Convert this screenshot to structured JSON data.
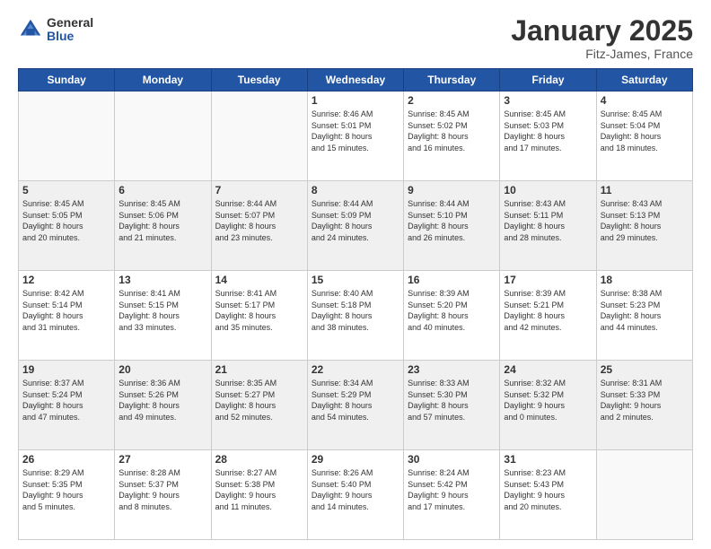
{
  "logo": {
    "general": "General",
    "blue": "Blue"
  },
  "title": "January 2025",
  "location": "Fitz-James, France",
  "days_header": [
    "Sunday",
    "Monday",
    "Tuesday",
    "Wednesday",
    "Thursday",
    "Friday",
    "Saturday"
  ],
  "weeks": [
    [
      {
        "day": "",
        "info": ""
      },
      {
        "day": "",
        "info": ""
      },
      {
        "day": "",
        "info": ""
      },
      {
        "day": "1",
        "info": "Sunrise: 8:46 AM\nSunset: 5:01 PM\nDaylight: 8 hours\nand 15 minutes."
      },
      {
        "day": "2",
        "info": "Sunrise: 8:45 AM\nSunset: 5:02 PM\nDaylight: 8 hours\nand 16 minutes."
      },
      {
        "day": "3",
        "info": "Sunrise: 8:45 AM\nSunset: 5:03 PM\nDaylight: 8 hours\nand 17 minutes."
      },
      {
        "day": "4",
        "info": "Sunrise: 8:45 AM\nSunset: 5:04 PM\nDaylight: 8 hours\nand 18 minutes."
      }
    ],
    [
      {
        "day": "5",
        "info": "Sunrise: 8:45 AM\nSunset: 5:05 PM\nDaylight: 8 hours\nand 20 minutes."
      },
      {
        "day": "6",
        "info": "Sunrise: 8:45 AM\nSunset: 5:06 PM\nDaylight: 8 hours\nand 21 minutes."
      },
      {
        "day": "7",
        "info": "Sunrise: 8:44 AM\nSunset: 5:07 PM\nDaylight: 8 hours\nand 23 minutes."
      },
      {
        "day": "8",
        "info": "Sunrise: 8:44 AM\nSunset: 5:09 PM\nDaylight: 8 hours\nand 24 minutes."
      },
      {
        "day": "9",
        "info": "Sunrise: 8:44 AM\nSunset: 5:10 PM\nDaylight: 8 hours\nand 26 minutes."
      },
      {
        "day": "10",
        "info": "Sunrise: 8:43 AM\nSunset: 5:11 PM\nDaylight: 8 hours\nand 28 minutes."
      },
      {
        "day": "11",
        "info": "Sunrise: 8:43 AM\nSunset: 5:13 PM\nDaylight: 8 hours\nand 29 minutes."
      }
    ],
    [
      {
        "day": "12",
        "info": "Sunrise: 8:42 AM\nSunset: 5:14 PM\nDaylight: 8 hours\nand 31 minutes."
      },
      {
        "day": "13",
        "info": "Sunrise: 8:41 AM\nSunset: 5:15 PM\nDaylight: 8 hours\nand 33 minutes."
      },
      {
        "day": "14",
        "info": "Sunrise: 8:41 AM\nSunset: 5:17 PM\nDaylight: 8 hours\nand 35 minutes."
      },
      {
        "day": "15",
        "info": "Sunrise: 8:40 AM\nSunset: 5:18 PM\nDaylight: 8 hours\nand 38 minutes."
      },
      {
        "day": "16",
        "info": "Sunrise: 8:39 AM\nSunset: 5:20 PM\nDaylight: 8 hours\nand 40 minutes."
      },
      {
        "day": "17",
        "info": "Sunrise: 8:39 AM\nSunset: 5:21 PM\nDaylight: 8 hours\nand 42 minutes."
      },
      {
        "day": "18",
        "info": "Sunrise: 8:38 AM\nSunset: 5:23 PM\nDaylight: 8 hours\nand 44 minutes."
      }
    ],
    [
      {
        "day": "19",
        "info": "Sunrise: 8:37 AM\nSunset: 5:24 PM\nDaylight: 8 hours\nand 47 minutes."
      },
      {
        "day": "20",
        "info": "Sunrise: 8:36 AM\nSunset: 5:26 PM\nDaylight: 8 hours\nand 49 minutes."
      },
      {
        "day": "21",
        "info": "Sunrise: 8:35 AM\nSunset: 5:27 PM\nDaylight: 8 hours\nand 52 minutes."
      },
      {
        "day": "22",
        "info": "Sunrise: 8:34 AM\nSunset: 5:29 PM\nDaylight: 8 hours\nand 54 minutes."
      },
      {
        "day": "23",
        "info": "Sunrise: 8:33 AM\nSunset: 5:30 PM\nDaylight: 8 hours\nand 57 minutes."
      },
      {
        "day": "24",
        "info": "Sunrise: 8:32 AM\nSunset: 5:32 PM\nDaylight: 9 hours\nand 0 minutes."
      },
      {
        "day": "25",
        "info": "Sunrise: 8:31 AM\nSunset: 5:33 PM\nDaylight: 9 hours\nand 2 minutes."
      }
    ],
    [
      {
        "day": "26",
        "info": "Sunrise: 8:29 AM\nSunset: 5:35 PM\nDaylight: 9 hours\nand 5 minutes."
      },
      {
        "day": "27",
        "info": "Sunrise: 8:28 AM\nSunset: 5:37 PM\nDaylight: 9 hours\nand 8 minutes."
      },
      {
        "day": "28",
        "info": "Sunrise: 8:27 AM\nSunset: 5:38 PM\nDaylight: 9 hours\nand 11 minutes."
      },
      {
        "day": "29",
        "info": "Sunrise: 8:26 AM\nSunset: 5:40 PM\nDaylight: 9 hours\nand 14 minutes."
      },
      {
        "day": "30",
        "info": "Sunrise: 8:24 AM\nSunset: 5:42 PM\nDaylight: 9 hours\nand 17 minutes."
      },
      {
        "day": "31",
        "info": "Sunrise: 8:23 AM\nSunset: 5:43 PM\nDaylight: 9 hours\nand 20 minutes."
      },
      {
        "day": "",
        "info": ""
      }
    ]
  ]
}
